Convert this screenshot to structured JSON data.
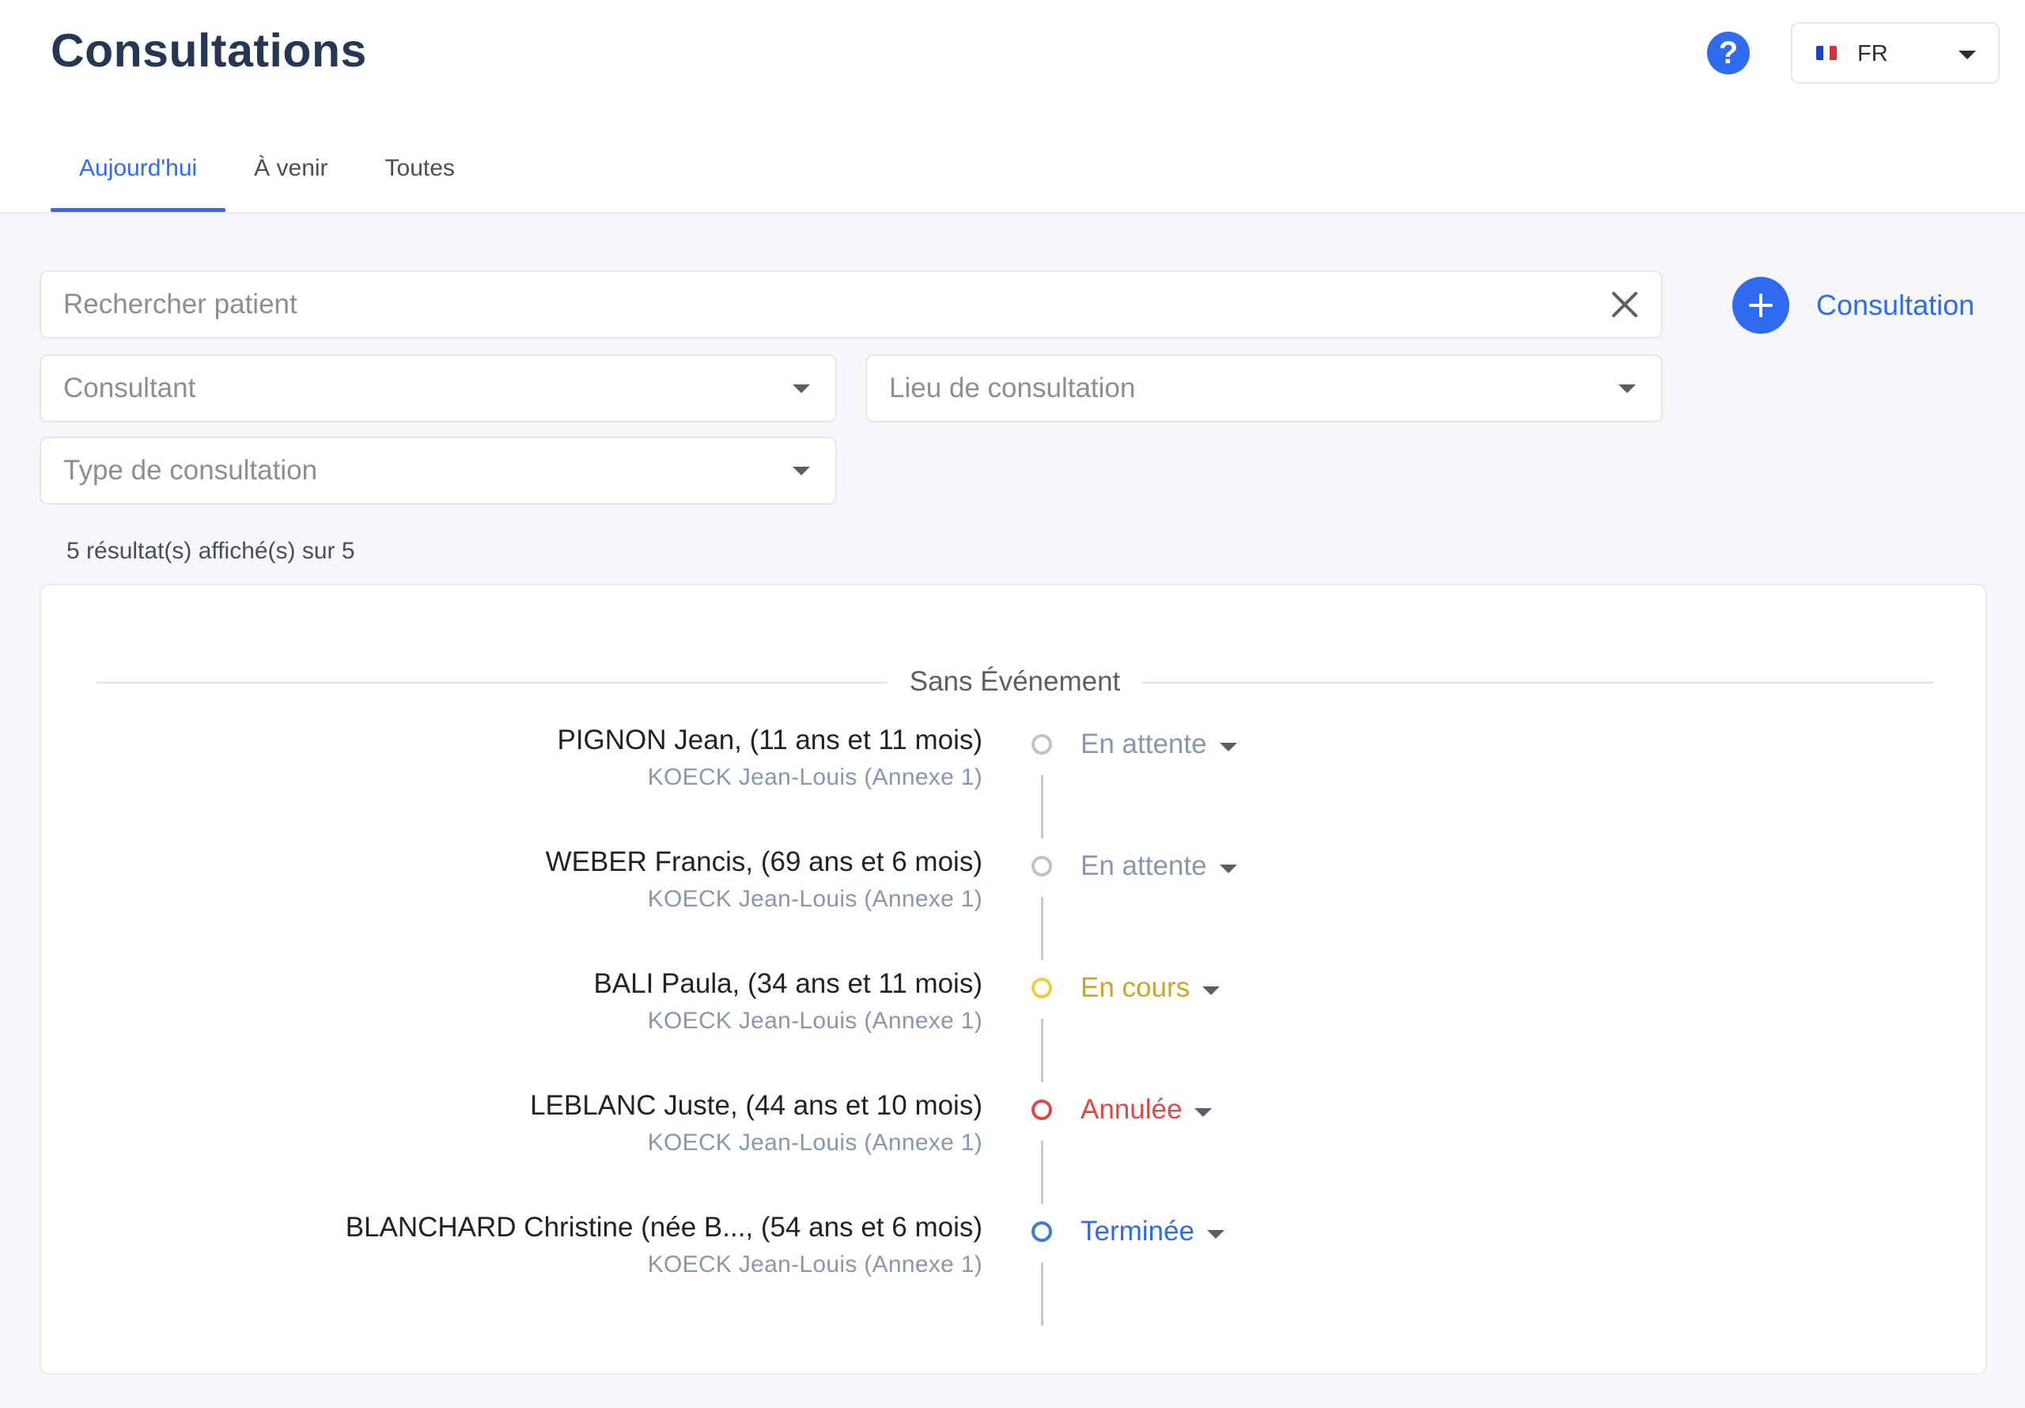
{
  "header": {
    "title": "Consultations",
    "help_label": "?",
    "language": {
      "code": "FR",
      "flag_colors": [
        "#1f3fbf",
        "#ffffff",
        "#e02b35"
      ]
    }
  },
  "tabs": [
    {
      "label": "Aujourd'hui",
      "active": true
    },
    {
      "label": "À venir",
      "active": false
    },
    {
      "label": "Toutes",
      "active": false
    }
  ],
  "filters": {
    "search_placeholder": "Rechercher patient",
    "consultant_placeholder": "Consultant",
    "location_placeholder": "Lieu de consultation",
    "type_placeholder": "Type de consultation"
  },
  "actions": {
    "add_consultation_label": "Consultation"
  },
  "results": {
    "count_text": "5 résultat(s) affiché(s) sur 5"
  },
  "timeline": {
    "group_label": "Sans Événement",
    "entries": [
      {
        "patient": "PIGNON Jean, (11 ans et 11 mois)",
        "consultant": "KOECK Jean-Louis (Annexe 1)",
        "status": "En attente",
        "status_color": "#8896ae",
        "dot_color": "#c0c4ca"
      },
      {
        "patient": "WEBER Francis, (69 ans et 6 mois)",
        "consultant": "KOECK Jean-Louis (Annexe 1)",
        "status": "En attente",
        "status_color": "#8896ae",
        "dot_color": "#c0c4ca"
      },
      {
        "patient": "BALI Paula, (34 ans et 11 mois)",
        "consultant": "KOECK Jean-Louis (Annexe 1)",
        "status": "En cours",
        "status_color": "#cda42a",
        "dot_color": "#f2cb3c"
      },
      {
        "patient": "LEBLANC Juste, (44 ans et 10 mois)",
        "consultant": "KOECK Jean-Louis (Annexe 1)",
        "status": "Annulée",
        "status_color": "#e04848",
        "dot_color": "#e04848"
      },
      {
        "patient": "BLANCHARD Christine (née B..., (54 ans et 6 mois)",
        "consultant": "KOECK Jean-Louis (Annexe 1)",
        "status": "Terminée",
        "status_color": "#2f6bf0",
        "dot_color": "#3a7bd5"
      }
    ]
  },
  "colors": {
    "accent": "#2f6bf0",
    "title": "#263756"
  }
}
